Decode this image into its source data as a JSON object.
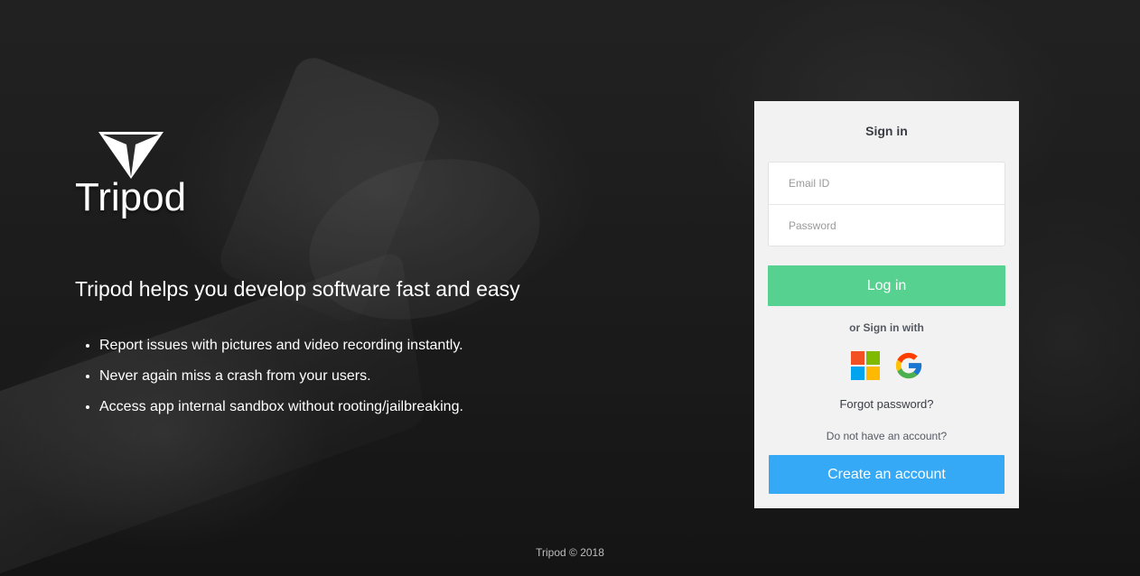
{
  "brand": {
    "name": "Tripod",
    "logo_icon": "tripod-triangle-logo"
  },
  "hero": {
    "tagline": "Tripod helps you develop software fast and easy",
    "features": [
      "Report issues with pictures and video recording instantly.",
      "Never again miss a crash from your users.",
      "Access app internal sandbox without rooting/jailbreaking."
    ]
  },
  "signin": {
    "title": "Sign in",
    "email_placeholder": "Email ID",
    "password_placeholder": "Password",
    "login_label": "Log in",
    "or_text": "or Sign in with",
    "social_icons": [
      "microsoft-icon",
      "google-icon"
    ],
    "forgot_label": "Forgot password?",
    "no_account_text": "Do not have an account?",
    "create_label": "Create an account"
  },
  "footer": {
    "text": "Tripod © 2018"
  },
  "colors": {
    "login_button": "#56d18f",
    "create_button": "#35a9f5",
    "card_background": "#f2f2f2",
    "microsoft_red": "#f25022",
    "microsoft_green": "#7fba00",
    "microsoft_blue": "#00a4ef",
    "microsoft_yellow": "#ffb900"
  }
}
